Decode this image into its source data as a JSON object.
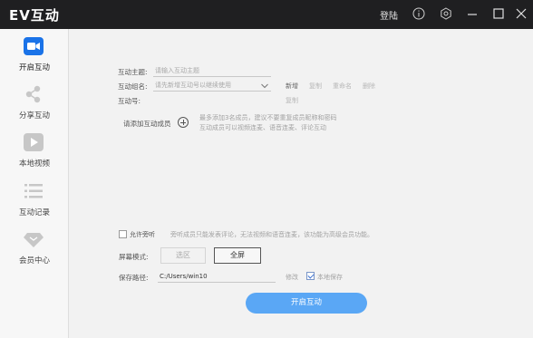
{
  "app": {
    "title": "EV互动"
  },
  "titlebar": {
    "login_label": "登陆",
    "icons": [
      "info-icon",
      "settings-icon",
      "minimize-icon",
      "maximize-icon",
      "close-icon"
    ]
  },
  "sidebar": {
    "accent_color": "#1a73e8",
    "items": [
      {
        "label": "开启互动",
        "icon": "video-camera-icon",
        "active": true
      },
      {
        "label": "分享互动",
        "icon": "share-icon"
      },
      {
        "label": "本地视频",
        "icon": "play-icon"
      },
      {
        "label": "互动记录",
        "icon": "list-icon"
      },
      {
        "label": "会员中心",
        "icon": "diamond-icon"
      }
    ]
  },
  "form": {
    "topic": {
      "label": "互动主题:",
      "placeholder": "请输入互动主题"
    },
    "group": {
      "label": "互动组名:",
      "placeholder": "请先新增互动号以继续使用"
    },
    "number": {
      "label": "互动号:"
    },
    "group_actions": [
      "新增",
      "复制",
      "重命名",
      "删除"
    ],
    "copy_label": "复制"
  },
  "members": {
    "add_label": "请添加互动成员",
    "hint_line1": "最多添加3名成员，建议不要重复成员昵称和密码",
    "hint_line2": "互动成员可以视频连麦、语音连麦、评论互动"
  },
  "audience": {
    "label": "允许旁听",
    "hint": "旁听成员只能发表评论，无法视频和语音连麦，该功能为高级会员功能。"
  },
  "screen_mode": {
    "label": "屏幕模式:",
    "options": [
      "选区",
      "全屏"
    ],
    "selected": "全屏"
  },
  "save": {
    "label": "保存路径:",
    "path": "C:/Users/win10",
    "modify": "修改",
    "local_save": "本地保存"
  },
  "start_button": {
    "label": "开启互动",
    "color": "#5aa7f5"
  }
}
